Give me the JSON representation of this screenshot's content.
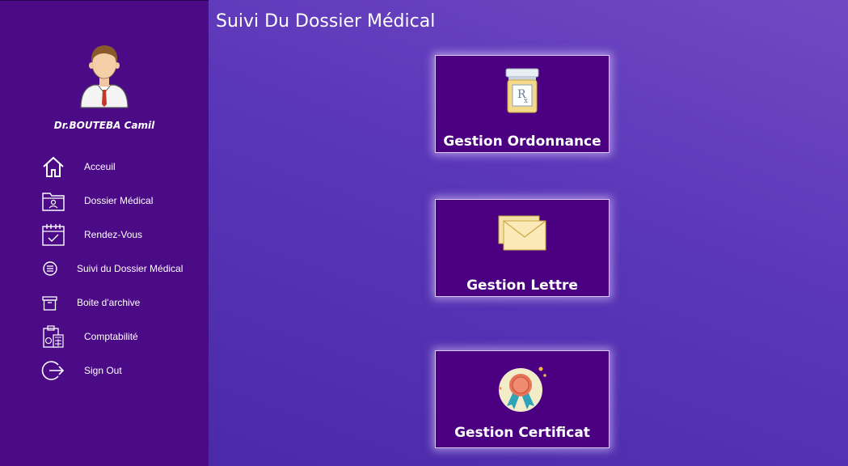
{
  "sidebar": {
    "doctor_name": "Dr.BOUTEBA Camil",
    "items": [
      {
        "label": "Acceuil",
        "icon": "home-icon"
      },
      {
        "label": "Dossier Médical",
        "icon": "folder-user-icon"
      },
      {
        "label": "Rendez-Vous",
        "icon": "calendar-check-icon"
      },
      {
        "label": "Suivi du Dossier Médical",
        "icon": "list-circle-icon"
      },
      {
        "label": "Boite d'archive",
        "icon": "archive-box-icon"
      },
      {
        "label": "Comptabilité",
        "icon": "clipboard-calculator-icon"
      },
      {
        "label": "Sign Out",
        "icon": "sign-out-icon"
      }
    ]
  },
  "main": {
    "title": "Suivi Du Dossier Médical",
    "cards": [
      {
        "label": "Gestion Ordonnance",
        "icon": "prescription-jar-icon"
      },
      {
        "label": "Gestion Lettre",
        "icon": "envelope-icon"
      },
      {
        "label": "Gestion Certificat",
        "icon": "award-ribbon-icon"
      }
    ]
  },
  "colors": {
    "sidebar_bg": "#4b0a86",
    "main_bg": "#5a36b8",
    "card_bg": "#4a0080",
    "text": "#ffffff"
  }
}
